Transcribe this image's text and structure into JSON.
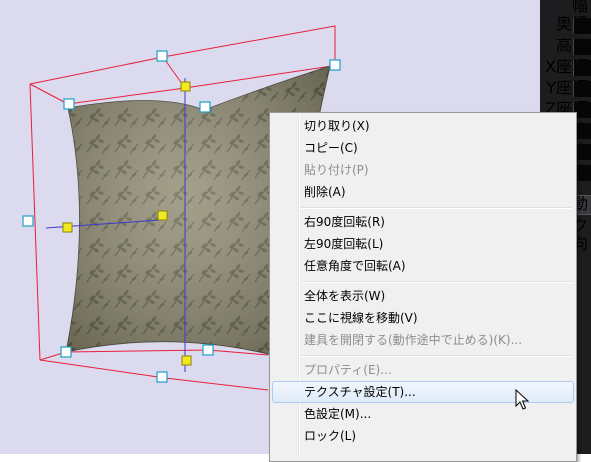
{
  "viewport": {
    "background": "#dcdaee",
    "bbox_color": "#e8203c",
    "object": "cushion"
  },
  "side_panel": {
    "labels": [
      "幅",
      "奥行",
      "高さ",
      "X座標",
      "Y座標",
      "Z座標",
      "度",
      "度",
      "度",
      "動",
      "ック",
      "向"
    ]
  },
  "context_menu": {
    "items": [
      {
        "label": "切り取り(X)",
        "enabled": true
      },
      {
        "label": "コピー(C)",
        "enabled": true
      },
      {
        "label": "貼り付け(P)",
        "enabled": false
      },
      {
        "label": "削除(A)",
        "enabled": true
      },
      {
        "label": "右90度回転(R)",
        "enabled": true
      },
      {
        "label": "左90度回転(L)",
        "enabled": true
      },
      {
        "label": "任意角度で回転(A)",
        "enabled": true
      },
      {
        "label": "全体を表示(W)",
        "enabled": true
      },
      {
        "label": "ここに視線を移動(V)",
        "enabled": true
      },
      {
        "label": "建具を開閉する(動作途中で止める)(K)...",
        "enabled": false
      },
      {
        "label": "プロパティ(E)...",
        "enabled": false
      },
      {
        "label": "テクスチャ設定(T)...",
        "enabled": true,
        "highlighted": true
      },
      {
        "label": "色設定(M)...",
        "enabled": true
      },
      {
        "label": "ロック(L)",
        "enabled": true
      }
    ]
  }
}
